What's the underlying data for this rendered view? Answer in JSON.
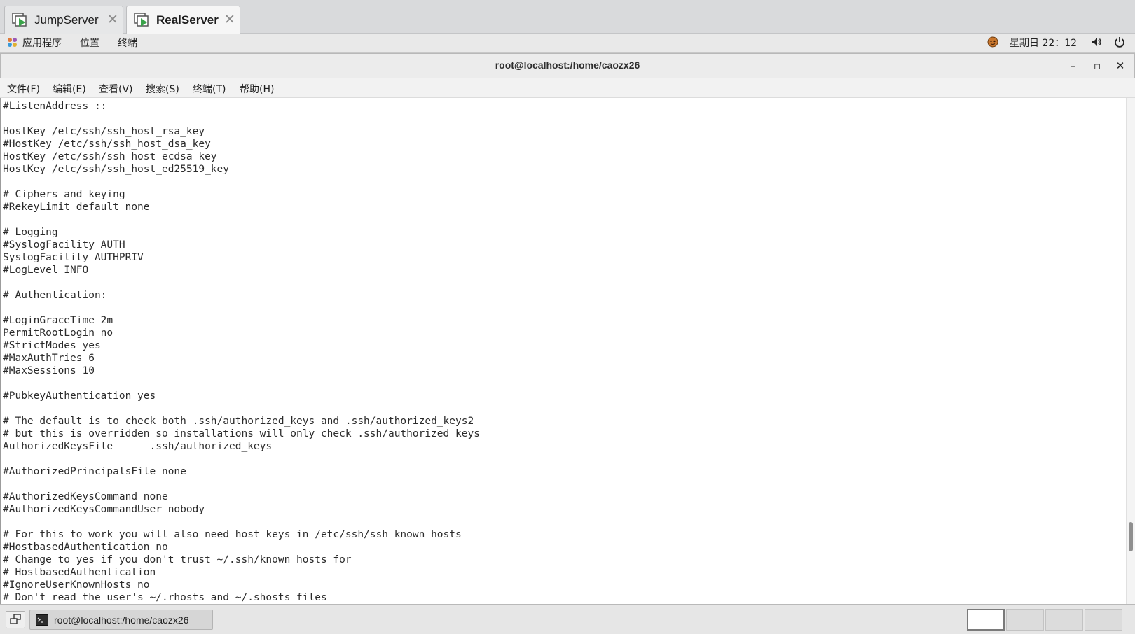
{
  "vm_tabs": [
    {
      "label": "JumpServer",
      "active": false
    },
    {
      "label": "RealServer",
      "active": true
    }
  ],
  "gnome_bar": {
    "applications": "应用程序",
    "places": "位置",
    "terminal": "终端",
    "clock": "星期日 22：12",
    "icons": [
      "app-menu-icon",
      "notification-face-icon",
      "volume-icon",
      "power-icon"
    ]
  },
  "window": {
    "title": "root@localhost:/home/caozx26",
    "minimize": "–",
    "maximize": "▫",
    "close": "✕"
  },
  "menubar": {
    "file": "文件(F)",
    "edit": "编辑(E)",
    "view": "查看(V)",
    "search": "搜索(S)",
    "terminal": "终端(T)",
    "help": "帮助(H)"
  },
  "terminal_lines": [
    "#ListenAddress ::",
    "",
    "HostKey /etc/ssh/ssh_host_rsa_key",
    "#HostKey /etc/ssh/ssh_host_dsa_key",
    "HostKey /etc/ssh/ssh_host_ecdsa_key",
    "HostKey /etc/ssh/ssh_host_ed25519_key",
    "",
    "# Ciphers and keying",
    "#RekeyLimit default none",
    "",
    "# Logging",
    "#SyslogFacility AUTH",
    "SyslogFacility AUTHPRIV",
    "#LogLevel INFO",
    "",
    "# Authentication:",
    "",
    "#LoginGraceTime 2m",
    "PermitRootLogin no",
    "#StrictModes yes",
    "#MaxAuthTries 6",
    "#MaxSessions 10",
    "",
    "#PubkeyAuthentication yes",
    "",
    "# The default is to check both .ssh/authorized_keys and .ssh/authorized_keys2",
    "# but this is overridden so installations will only check .ssh/authorized_keys",
    "AuthorizedKeysFile      .ssh/authorized_keys",
    "",
    "#AuthorizedPrincipalsFile none",
    "",
    "#AuthorizedKeysCommand none",
    "#AuthorizedKeysCommandUser nobody",
    "",
    "# For this to work you will also need host keys in /etc/ssh/ssh_known_hosts",
    "#HostbasedAuthentication no",
    "# Change to yes if you don't trust ~/.ssh/known_hosts for",
    "# HostbasedAuthentication",
    "#IgnoreUserKnownHosts no",
    "# Don't read the user's ~/.rhosts and ~/.shosts files"
  ],
  "taskbar": {
    "task_label": "root@localhost:/home/caozx26",
    "workspaces": 4,
    "active_workspace": 1
  },
  "colors": {
    "vm_play_green": "#3aa34a",
    "terminal_text": "#2b2b2b",
    "panel_bg": "#e6e6e6"
  }
}
